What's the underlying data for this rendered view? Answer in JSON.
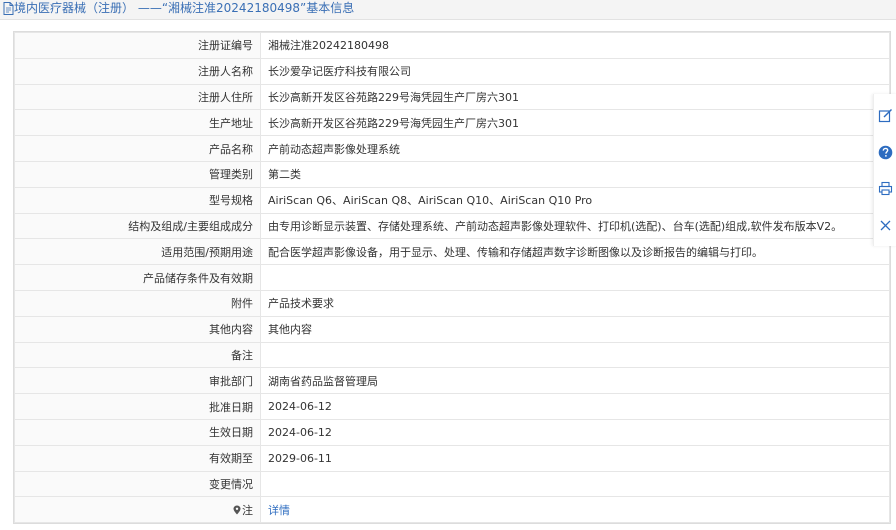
{
  "header": {
    "title": "境内医疗器械（注册） ——“湘械注准20242180498”基本信息"
  },
  "rows": [
    {
      "label": "注册证编号",
      "value": "湘械注准20242180498"
    },
    {
      "label": "注册人名称",
      "value": "长沙爱孕记医疗科技有限公司"
    },
    {
      "label": "注册人住所",
      "value": "长沙高新开发区谷苑路229号海凭园生产厂房六301"
    },
    {
      "label": "生产地址",
      "value": "长沙高新开发区谷苑路229号海凭园生产厂房六301"
    },
    {
      "label": "产品名称",
      "value": "产前动态超声影像处理系统"
    },
    {
      "label": "管理类别",
      "value": "第二类"
    },
    {
      "label": "型号规格",
      "value": "AiriScan Q6、AiriScan Q8、AiriScan Q10、AiriScan Q10 Pro"
    },
    {
      "label": "结构及组成/主要组成成分",
      "value": "由专用诊断显示装置、存储处理系统、产前动态超声影像处理软件、打印机(选配)、台车(选配)组成,软件发布版本V2。"
    },
    {
      "label": "适用范围/预期用途",
      "value": "配合医学超声影像设备，用于显示、处理、传输和存储超声数字诊断图像以及诊断报告的编辑与打印。"
    },
    {
      "label": "产品储存条件及有效期",
      "value": ""
    },
    {
      "label": "附件",
      "value": "产品技术要求"
    },
    {
      "label": "其他内容",
      "value": "其他内容"
    },
    {
      "label": "备注",
      "value": ""
    },
    {
      "label": "审批部门",
      "value": "湖南省药品监督管理局"
    },
    {
      "label": "批准日期",
      "value": "2024-06-12"
    },
    {
      "label": "生效日期",
      "value": "2024-06-12"
    },
    {
      "label": "有效期至",
      "value": "2029-06-11"
    },
    {
      "label": "变更情况",
      "value": ""
    }
  ],
  "note": {
    "label": "注",
    "link": "详情"
  },
  "colors": {
    "link": "#2d6cc0",
    "header_text": "#3a6fb5",
    "side_icon": "#2d6cc0"
  },
  "side_icons": [
    "edit-icon",
    "help-icon",
    "print-icon",
    "close-icon"
  ]
}
